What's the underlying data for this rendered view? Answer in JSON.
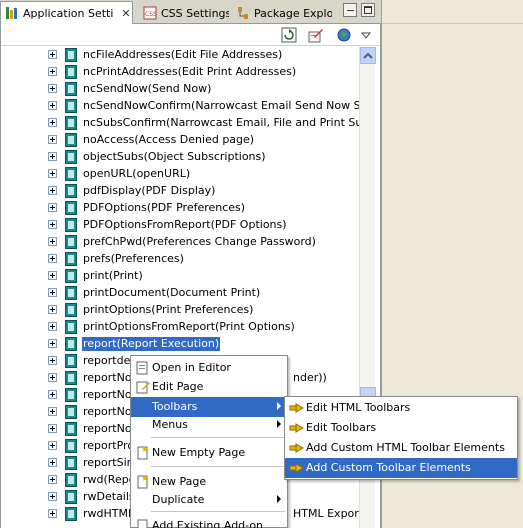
{
  "tabs": [
    {
      "label": "Application Setti",
      "active": true,
      "close": "✕"
    },
    {
      "label": "CSS Settings",
      "active": false
    },
    {
      "label": "Package Explor",
      "active": false
    }
  ],
  "tree": {
    "rows": [
      {
        "label": "ncFileAddresses(Edit File Addresses)"
      },
      {
        "label": "ncPrintAddresses(Edit Print Addresses)"
      },
      {
        "label": "ncSendNow(Send Now)"
      },
      {
        "label": "ncSendNowConfirm(Narrowcast Email Send Now Subscripti"
      },
      {
        "label": "ncSubsConfirm(Narrowcast Email, File and Print Subscripti"
      },
      {
        "label": "noAccess(Access Denied page)"
      },
      {
        "label": "objectSubs(Object Subscriptions)"
      },
      {
        "label": "openURL(openURL)"
      },
      {
        "label": "pdfDisplay(PDF Display)"
      },
      {
        "label": "PDFOptions(PDF Preferences)"
      },
      {
        "label": "PDFOptionsFromReport(PDF Options)"
      },
      {
        "label": "prefChPwd(Preferences Change Password)"
      },
      {
        "label": "prefs(Preferences)"
      },
      {
        "label": "print(Print)"
      },
      {
        "label": "printDocument(Document Print)"
      },
      {
        "label": "printOptions(Print Preferences)"
      },
      {
        "label": "printOptionsFromReport(Print Options)"
      },
      {
        "label": "report(Report Execution)",
        "selected": true
      },
      {
        "label": "reportdet"
      },
      {
        "label": "reportNo",
        "suffix": "nder))"
      },
      {
        "label": "reportNo"
      },
      {
        "label": "reportNo"
      },
      {
        "label": "reportNo"
      },
      {
        "label": "reportPro"
      },
      {
        "label": "reportSim"
      },
      {
        "label": "rwd(Repo"
      },
      {
        "label": "rwDetails"
      },
      {
        "label": "rwdHTML",
        "suffix": "HTML Export)"
      }
    ]
  },
  "context_menu": {
    "items": [
      {
        "label": "Open in Editor",
        "icon": "open-editor-icon"
      },
      {
        "label": "Edit Page",
        "icon": "edit-page-icon"
      },
      {
        "label": "Toolbars",
        "submenu": true,
        "highlighted": true
      },
      {
        "label": "Menus",
        "submenu": true
      },
      {
        "label": "New Empty Page",
        "icon": "new-page-icon"
      },
      {
        "label": "New Page",
        "icon": "new-page-icon"
      },
      {
        "label": "Duplicate",
        "submenu": true
      },
      {
        "label": "Add Existing Add-on"
      }
    ]
  },
  "submenu": {
    "items": [
      {
        "label": "Edit HTML Toolbars",
        "icon": "toolbar-arrow-icon"
      },
      {
        "label": "Edit Toolbars",
        "icon": "toolbar-arrow-icon"
      },
      {
        "label": "Add Custom HTML Toolbar Elements",
        "icon": "toolbar-arrow-icon"
      },
      {
        "label": "Add Custom Toolbar Elements",
        "icon": "toolbar-arrow-icon",
        "highlighted": true
      }
    ]
  },
  "colors": {
    "selection": "#316ac5",
    "chrome": "#ece9d8",
    "tree_icon": "#1d8a8a"
  }
}
